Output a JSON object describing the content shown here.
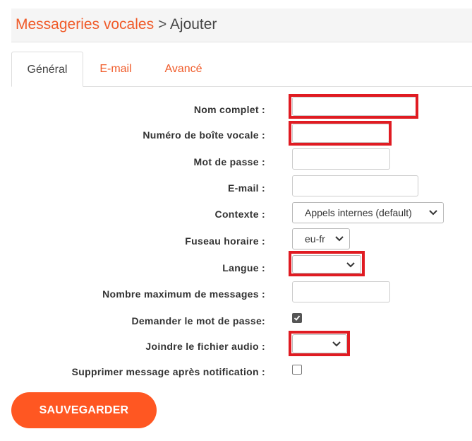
{
  "breadcrumb": {
    "parent": "Messageries vocales",
    "separator": ">",
    "current": "Ajouter"
  },
  "tabs": [
    {
      "label": "Général",
      "active": true
    },
    {
      "label": "E-mail",
      "active": false
    },
    {
      "label": "Avancé",
      "active": false
    }
  ],
  "form": {
    "full_name": {
      "label": "Nom complet :",
      "value": ""
    },
    "mailbox_number": {
      "label": "Numéro de boîte vocale :",
      "value": ""
    },
    "password": {
      "label": "Mot de passe :",
      "value": ""
    },
    "email": {
      "label": "E-mail :",
      "value": ""
    },
    "context": {
      "label": "Contexte :",
      "selected": "Appels internes (default)"
    },
    "timezone": {
      "label": "Fuseau horaire :",
      "selected": "eu-fr"
    },
    "language": {
      "label": "Langue :",
      "selected": ""
    },
    "max_messages": {
      "label": "Nombre maximum de messages :",
      "value": ""
    },
    "ask_password": {
      "label": "Demander le mot de passe:",
      "checked": true
    },
    "attach_audio": {
      "label": "Joindre le fichier audio :",
      "selected": ""
    },
    "delete_after_notify": {
      "label": "Supprimer message après notification :",
      "checked": false
    }
  },
  "save_button": {
    "label": "SAUVEGARDER"
  },
  "colors": {
    "accent": "#f05a28",
    "button": "#ff5722",
    "highlight": "#e01b22"
  },
  "icons": {
    "select_arrow": "chevron-down-icon",
    "checkbox_check": "check-icon"
  }
}
